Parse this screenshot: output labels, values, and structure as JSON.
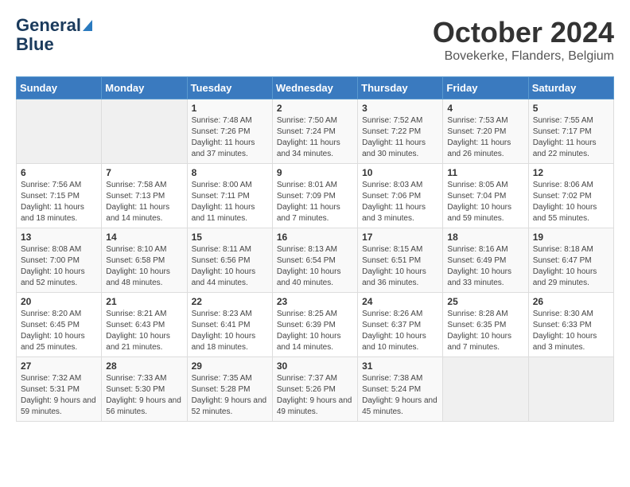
{
  "logo": {
    "line1": "General",
    "line2": "Blue"
  },
  "title": "October 2024",
  "location": "Bovekerke, Flanders, Belgium",
  "days_of_week": [
    "Sunday",
    "Monday",
    "Tuesday",
    "Wednesday",
    "Thursday",
    "Friday",
    "Saturday"
  ],
  "weeks": [
    [
      {
        "day": "",
        "info": ""
      },
      {
        "day": "",
        "info": ""
      },
      {
        "day": "1",
        "info": "Sunrise: 7:48 AM\nSunset: 7:26 PM\nDaylight: 11 hours and 37 minutes."
      },
      {
        "day": "2",
        "info": "Sunrise: 7:50 AM\nSunset: 7:24 PM\nDaylight: 11 hours and 34 minutes."
      },
      {
        "day": "3",
        "info": "Sunrise: 7:52 AM\nSunset: 7:22 PM\nDaylight: 11 hours and 30 minutes."
      },
      {
        "day": "4",
        "info": "Sunrise: 7:53 AM\nSunset: 7:20 PM\nDaylight: 11 hours and 26 minutes."
      },
      {
        "day": "5",
        "info": "Sunrise: 7:55 AM\nSunset: 7:17 PM\nDaylight: 11 hours and 22 minutes."
      }
    ],
    [
      {
        "day": "6",
        "info": "Sunrise: 7:56 AM\nSunset: 7:15 PM\nDaylight: 11 hours and 18 minutes."
      },
      {
        "day": "7",
        "info": "Sunrise: 7:58 AM\nSunset: 7:13 PM\nDaylight: 11 hours and 14 minutes."
      },
      {
        "day": "8",
        "info": "Sunrise: 8:00 AM\nSunset: 7:11 PM\nDaylight: 11 hours and 11 minutes."
      },
      {
        "day": "9",
        "info": "Sunrise: 8:01 AM\nSunset: 7:09 PM\nDaylight: 11 hours and 7 minutes."
      },
      {
        "day": "10",
        "info": "Sunrise: 8:03 AM\nSunset: 7:06 PM\nDaylight: 11 hours and 3 minutes."
      },
      {
        "day": "11",
        "info": "Sunrise: 8:05 AM\nSunset: 7:04 PM\nDaylight: 10 hours and 59 minutes."
      },
      {
        "day": "12",
        "info": "Sunrise: 8:06 AM\nSunset: 7:02 PM\nDaylight: 10 hours and 55 minutes."
      }
    ],
    [
      {
        "day": "13",
        "info": "Sunrise: 8:08 AM\nSunset: 7:00 PM\nDaylight: 10 hours and 52 minutes."
      },
      {
        "day": "14",
        "info": "Sunrise: 8:10 AM\nSunset: 6:58 PM\nDaylight: 10 hours and 48 minutes."
      },
      {
        "day": "15",
        "info": "Sunrise: 8:11 AM\nSunset: 6:56 PM\nDaylight: 10 hours and 44 minutes."
      },
      {
        "day": "16",
        "info": "Sunrise: 8:13 AM\nSunset: 6:54 PM\nDaylight: 10 hours and 40 minutes."
      },
      {
        "day": "17",
        "info": "Sunrise: 8:15 AM\nSunset: 6:51 PM\nDaylight: 10 hours and 36 minutes."
      },
      {
        "day": "18",
        "info": "Sunrise: 8:16 AM\nSunset: 6:49 PM\nDaylight: 10 hours and 33 minutes."
      },
      {
        "day": "19",
        "info": "Sunrise: 8:18 AM\nSunset: 6:47 PM\nDaylight: 10 hours and 29 minutes."
      }
    ],
    [
      {
        "day": "20",
        "info": "Sunrise: 8:20 AM\nSunset: 6:45 PM\nDaylight: 10 hours and 25 minutes."
      },
      {
        "day": "21",
        "info": "Sunrise: 8:21 AM\nSunset: 6:43 PM\nDaylight: 10 hours and 21 minutes."
      },
      {
        "day": "22",
        "info": "Sunrise: 8:23 AM\nSunset: 6:41 PM\nDaylight: 10 hours and 18 minutes."
      },
      {
        "day": "23",
        "info": "Sunrise: 8:25 AM\nSunset: 6:39 PM\nDaylight: 10 hours and 14 minutes."
      },
      {
        "day": "24",
        "info": "Sunrise: 8:26 AM\nSunset: 6:37 PM\nDaylight: 10 hours and 10 minutes."
      },
      {
        "day": "25",
        "info": "Sunrise: 8:28 AM\nSunset: 6:35 PM\nDaylight: 10 hours and 7 minutes."
      },
      {
        "day": "26",
        "info": "Sunrise: 8:30 AM\nSunset: 6:33 PM\nDaylight: 10 hours and 3 minutes."
      }
    ],
    [
      {
        "day": "27",
        "info": "Sunrise: 7:32 AM\nSunset: 5:31 PM\nDaylight: 9 hours and 59 minutes."
      },
      {
        "day": "28",
        "info": "Sunrise: 7:33 AM\nSunset: 5:30 PM\nDaylight: 9 hours and 56 minutes."
      },
      {
        "day": "29",
        "info": "Sunrise: 7:35 AM\nSunset: 5:28 PM\nDaylight: 9 hours and 52 minutes."
      },
      {
        "day": "30",
        "info": "Sunrise: 7:37 AM\nSunset: 5:26 PM\nDaylight: 9 hours and 49 minutes."
      },
      {
        "day": "31",
        "info": "Sunrise: 7:38 AM\nSunset: 5:24 PM\nDaylight: 9 hours and 45 minutes."
      },
      {
        "day": "",
        "info": ""
      },
      {
        "day": "",
        "info": ""
      }
    ]
  ]
}
